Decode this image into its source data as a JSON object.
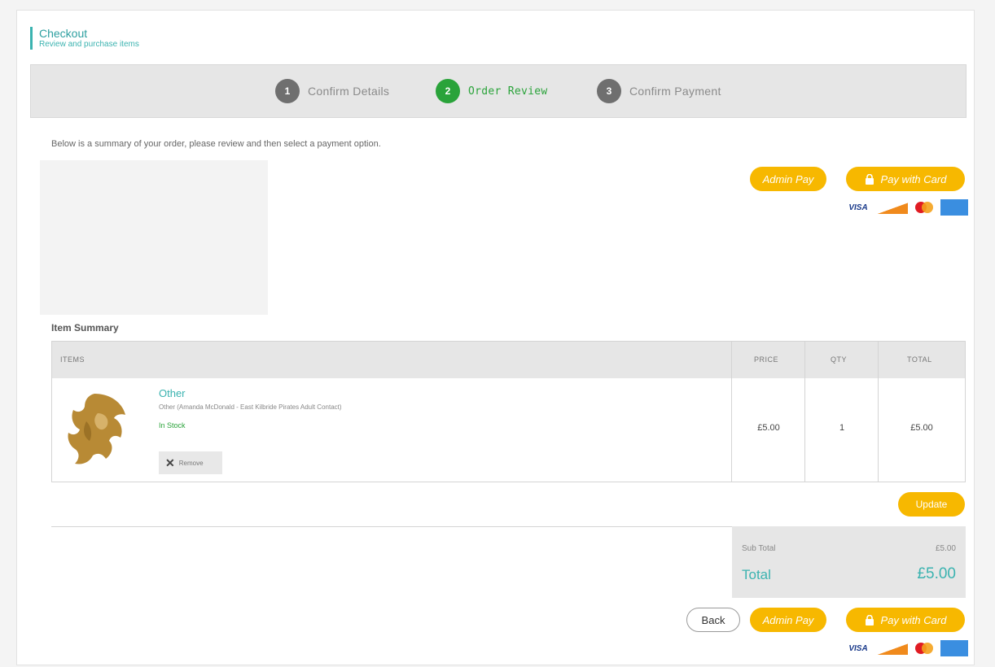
{
  "header": {
    "title": "Checkout",
    "subtitle": "Review and purchase items"
  },
  "steps": [
    {
      "number": "1",
      "label": "Confirm Details",
      "active": false
    },
    {
      "number": "2",
      "label": "Order Review",
      "active": true
    },
    {
      "number": "3",
      "label": "Confirm Payment",
      "active": false
    }
  ],
  "intro_text": "Below is a summary of your order, please review and then select a payment option.",
  "payment": {
    "admin_pay_label": "Admin Pay",
    "pay_card_label": "Pay with Card",
    "card_brands": [
      "VISA",
      "DISCOVER",
      "MASTERCARD",
      "AMEX"
    ],
    "accent_color": "#f7b800"
  },
  "item_summary": {
    "title": "Item Summary",
    "columns": [
      "ITEMS",
      "PRICE",
      "QTY",
      "TOTAL"
    ],
    "rows": [
      {
        "name": "Other",
        "description": "Other (Amanda McDonald - East Kilbride Pirates Adult Contact)",
        "stock": "In Stock",
        "remove_label": "Remove",
        "price": "£5.00",
        "qty": "1",
        "total": "£5.00",
        "image_icon": "lion-head-logo"
      }
    ]
  },
  "update_label": "Update",
  "totals": {
    "sub_total_label": "Sub Total",
    "sub_total_value": "£5.00",
    "total_label": "Total",
    "total_value": "£5.00"
  },
  "back_label": "Back",
  "colors": {
    "teal": "#3bb3b0",
    "green": "#2aa33a",
    "step_gray": "#6f6f6f"
  }
}
